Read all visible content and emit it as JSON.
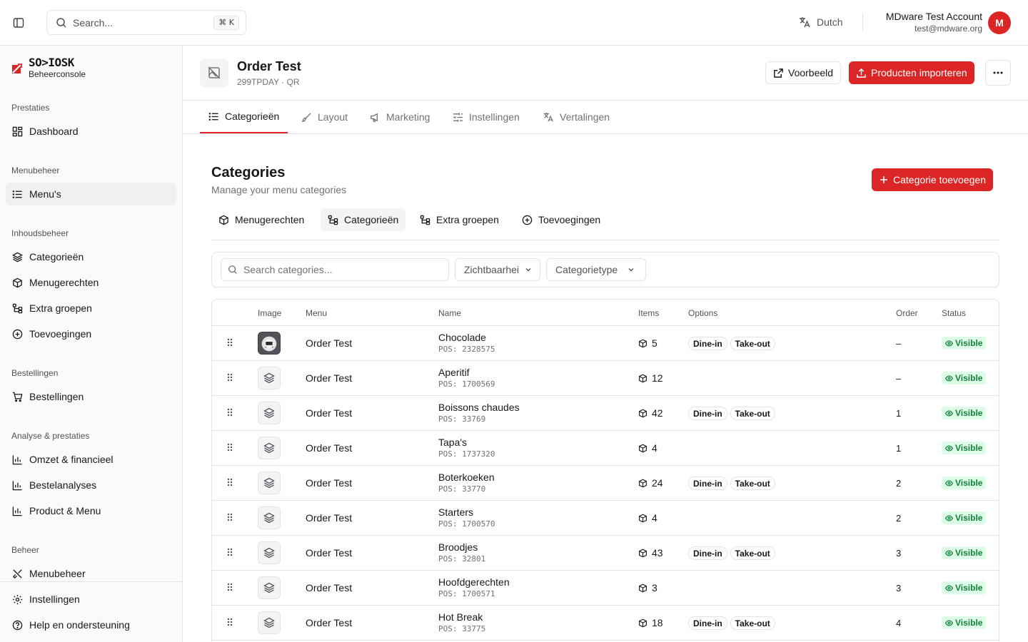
{
  "topbar": {
    "search_placeholder": "Search...",
    "search_shortcut": "⌘ K",
    "language": "Dutch",
    "account_name": "MDware Test Account",
    "account_email": "test@mdware.org",
    "avatar_initial": "M"
  },
  "brand": {
    "name": "SO>IOSK",
    "subtitle": "Beheerconsole"
  },
  "sidebar": {
    "groups": [
      {
        "label": "Prestaties",
        "items": [
          {
            "label": "Dashboard",
            "icon": "dashboard-icon"
          }
        ]
      },
      {
        "label": "Menubeheer",
        "items": [
          {
            "label": "Menu's",
            "icon": "list-icon"
          }
        ]
      },
      {
        "label": "Inhoudsbeheer",
        "items": [
          {
            "label": "Categorieën",
            "icon": "layers-icon"
          },
          {
            "label": "Menugerechten",
            "icon": "package-icon"
          },
          {
            "label": "Extra groepen",
            "icon": "tree-icon"
          },
          {
            "label": "Toevoegingen",
            "icon": "plus-circle-icon"
          }
        ]
      },
      {
        "label": "Bestellingen",
        "items": [
          {
            "label": "Bestellingen",
            "icon": "cart-icon"
          }
        ]
      },
      {
        "label": "Analyse & prestaties",
        "items": [
          {
            "label": "Omzet & financieel",
            "icon": "bar-chart-icon"
          },
          {
            "label": "Bestelanalyses",
            "icon": "bar-chart-icon"
          },
          {
            "label": "Product & Menu",
            "icon": "bar-chart-icon"
          }
        ]
      },
      {
        "label": "Beheer",
        "items": [
          {
            "label": "Menubeheer",
            "icon": "utensils-icon"
          }
        ]
      }
    ],
    "bottom": [
      {
        "label": "Instellingen",
        "icon": "gear-icon"
      },
      {
        "label": "Help en ondersteuning",
        "icon": "help-icon"
      }
    ]
  },
  "page": {
    "title": "Order Test",
    "subtitle": "299TPDAY · QR",
    "preview_label": "Voorbeeld",
    "import_label": "Producten importeren"
  },
  "tabs": [
    "Categorieën",
    "Layout",
    "Marketing",
    "Instellingen",
    "Vertalingen"
  ],
  "content": {
    "title": "Categories",
    "subtitle": "Manage your menu categories",
    "add_label": "Categorie toevoegen",
    "pills": [
      "Menugerechten",
      "Categorieën",
      "Extra groepen",
      "Toevoegingen"
    ],
    "filter_search_placeholder": "Search categories...",
    "filter_visibility": "Zichtbaarhei",
    "filter_type": "Categorietype"
  },
  "table": {
    "headers": {
      "image": "Image",
      "menu": "Menu",
      "name": "Name",
      "items": "Items",
      "options": "Options",
      "order": "Order",
      "status": "Status"
    },
    "rows": [
      {
        "menu": "Order Test",
        "name": "Chocolade",
        "pos": "POS: 2328575",
        "items": "5",
        "options": [
          "Dine-in",
          "Take-out"
        ],
        "order": "–",
        "status": "Visible",
        "photo": true
      },
      {
        "menu": "Order Test",
        "name": "Aperitif",
        "pos": "POS: 1700569",
        "items": "12",
        "options": [],
        "order": "–",
        "status": "Visible",
        "photo": false
      },
      {
        "menu": "Order Test",
        "name": "Boissons chaudes",
        "pos": "POS: 33769",
        "items": "42",
        "options": [
          "Dine-in",
          "Take-out"
        ],
        "order": "1",
        "status": "Visible",
        "photo": false
      },
      {
        "menu": "Order Test",
        "name": "Tapa's",
        "pos": "POS: 1737320",
        "items": "4",
        "options": [],
        "order": "1",
        "status": "Visible",
        "photo": false
      },
      {
        "menu": "Order Test",
        "name": "Boterkoeken",
        "pos": "POS: 33770",
        "items": "24",
        "options": [
          "Dine-in",
          "Take-out"
        ],
        "order": "2",
        "status": "Visible",
        "photo": false
      },
      {
        "menu": "Order Test",
        "name": "Starters",
        "pos": "POS: 1700570",
        "items": "4",
        "options": [],
        "order": "2",
        "status": "Visible",
        "photo": false
      },
      {
        "menu": "Order Test",
        "name": "Broodjes",
        "pos": "POS: 32801",
        "items": "43",
        "options": [
          "Dine-in",
          "Take-out"
        ],
        "order": "3",
        "status": "Visible",
        "photo": false
      },
      {
        "menu": "Order Test",
        "name": "Hoofdgerechten",
        "pos": "POS: 1700571",
        "items": "3",
        "options": [],
        "order": "3",
        "status": "Visible",
        "photo": false
      },
      {
        "menu": "Order Test",
        "name": "Hot Break",
        "pos": "POS: 33775",
        "items": "18",
        "options": [
          "Dine-in",
          "Take-out"
        ],
        "order": "4",
        "status": "Visible",
        "photo": false
      }
    ]
  },
  "colors": {
    "accent": "#dc2626",
    "status_bg": "#dcfce7",
    "status_fg": "#15803d",
    "border": "#e4e4e7"
  }
}
